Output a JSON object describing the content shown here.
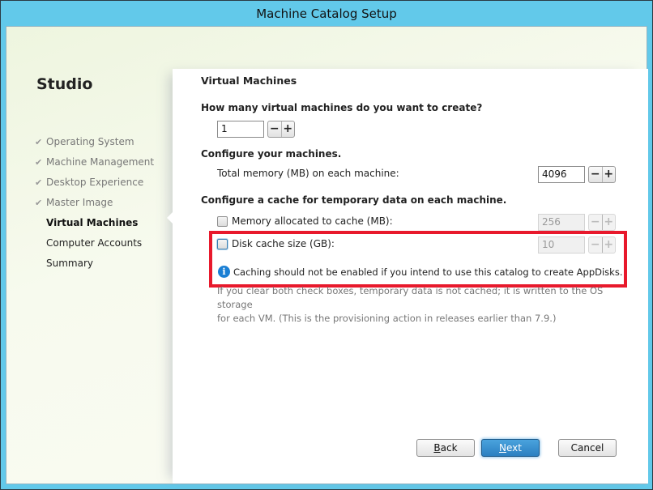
{
  "window": {
    "title": "Machine Catalog Setup"
  },
  "sidebar": {
    "brand": "Studio",
    "items": [
      {
        "label": "Operating System",
        "state": "completed",
        "icon": "check-icon"
      },
      {
        "label": "Machine Management",
        "state": "completed",
        "icon": "check-icon"
      },
      {
        "label": "Desktop Experience",
        "state": "completed",
        "icon": "check-icon"
      },
      {
        "label": "Master Image",
        "state": "completed",
        "icon": "check-icon"
      },
      {
        "label": "Virtual Machines",
        "state": "current"
      },
      {
        "label": "Computer Accounts",
        "state": "pending"
      },
      {
        "label": "Summary",
        "state": "pending"
      }
    ]
  },
  "main": {
    "section_title": "Virtual Machines",
    "vm_count": {
      "question": "How many virtual machines do you want to create?",
      "value": "1",
      "minus": "−",
      "plus": "+"
    },
    "configure": {
      "heading": "Configure your machines.",
      "memory_label": "Total memory (MB) on each machine:",
      "memory_value": "4096",
      "minus": "−",
      "plus": "+"
    },
    "cache": {
      "heading": "Configure a cache for temporary data on each machine.",
      "memory_cache": {
        "label": "Memory allocated to cache (MB):",
        "checked": false,
        "value": "256",
        "enabled": false
      },
      "disk_cache": {
        "label": "Disk cache size (GB):",
        "checked": false,
        "value": "10",
        "enabled": false
      },
      "minus": "−",
      "plus": "+",
      "highlight_color": "#e8192c"
    },
    "info_icon": "i",
    "info_text": "Caching should not be enabled if you intend to use this catalog to create AppDisks.",
    "note_line1": "If you clear both check boxes, temporary data is not cached; it is written to the OS storage",
    "note_line2": "for each VM. (This is the provisioning action in releases earlier than 7.9.)"
  },
  "footer": {
    "back": {
      "mnemonic": "B",
      "rest": "ack"
    },
    "next": {
      "mnemonic": "N",
      "rest": "ext"
    },
    "cancel": "Cancel"
  },
  "colors": {
    "titlebar": "#62c9ea",
    "primary_button": "#2b7fc1"
  }
}
